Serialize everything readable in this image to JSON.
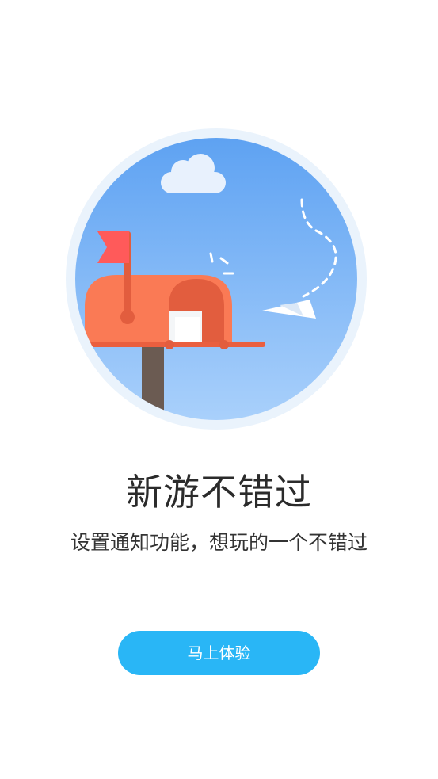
{
  "illustration": {
    "name": "mailbox-notification",
    "colors": {
      "ring": "#eaf3fc",
      "sky_top": "#5ea2f2",
      "sky_bottom": "#a9d0fb",
      "mailbox": "#fa7a55",
      "mailbox_dark": "#e25d3e",
      "flag": "#ff5a5a",
      "post": "#6b5b52",
      "cloud": "#e8f1fd",
      "paper_plane": "#ffffff"
    }
  },
  "content": {
    "title": "新游不错过",
    "subtitle": "设置通知功能，想玩的一个不错过"
  },
  "actions": {
    "primary_label": "马上体验",
    "primary_color": "#29b6f6"
  }
}
